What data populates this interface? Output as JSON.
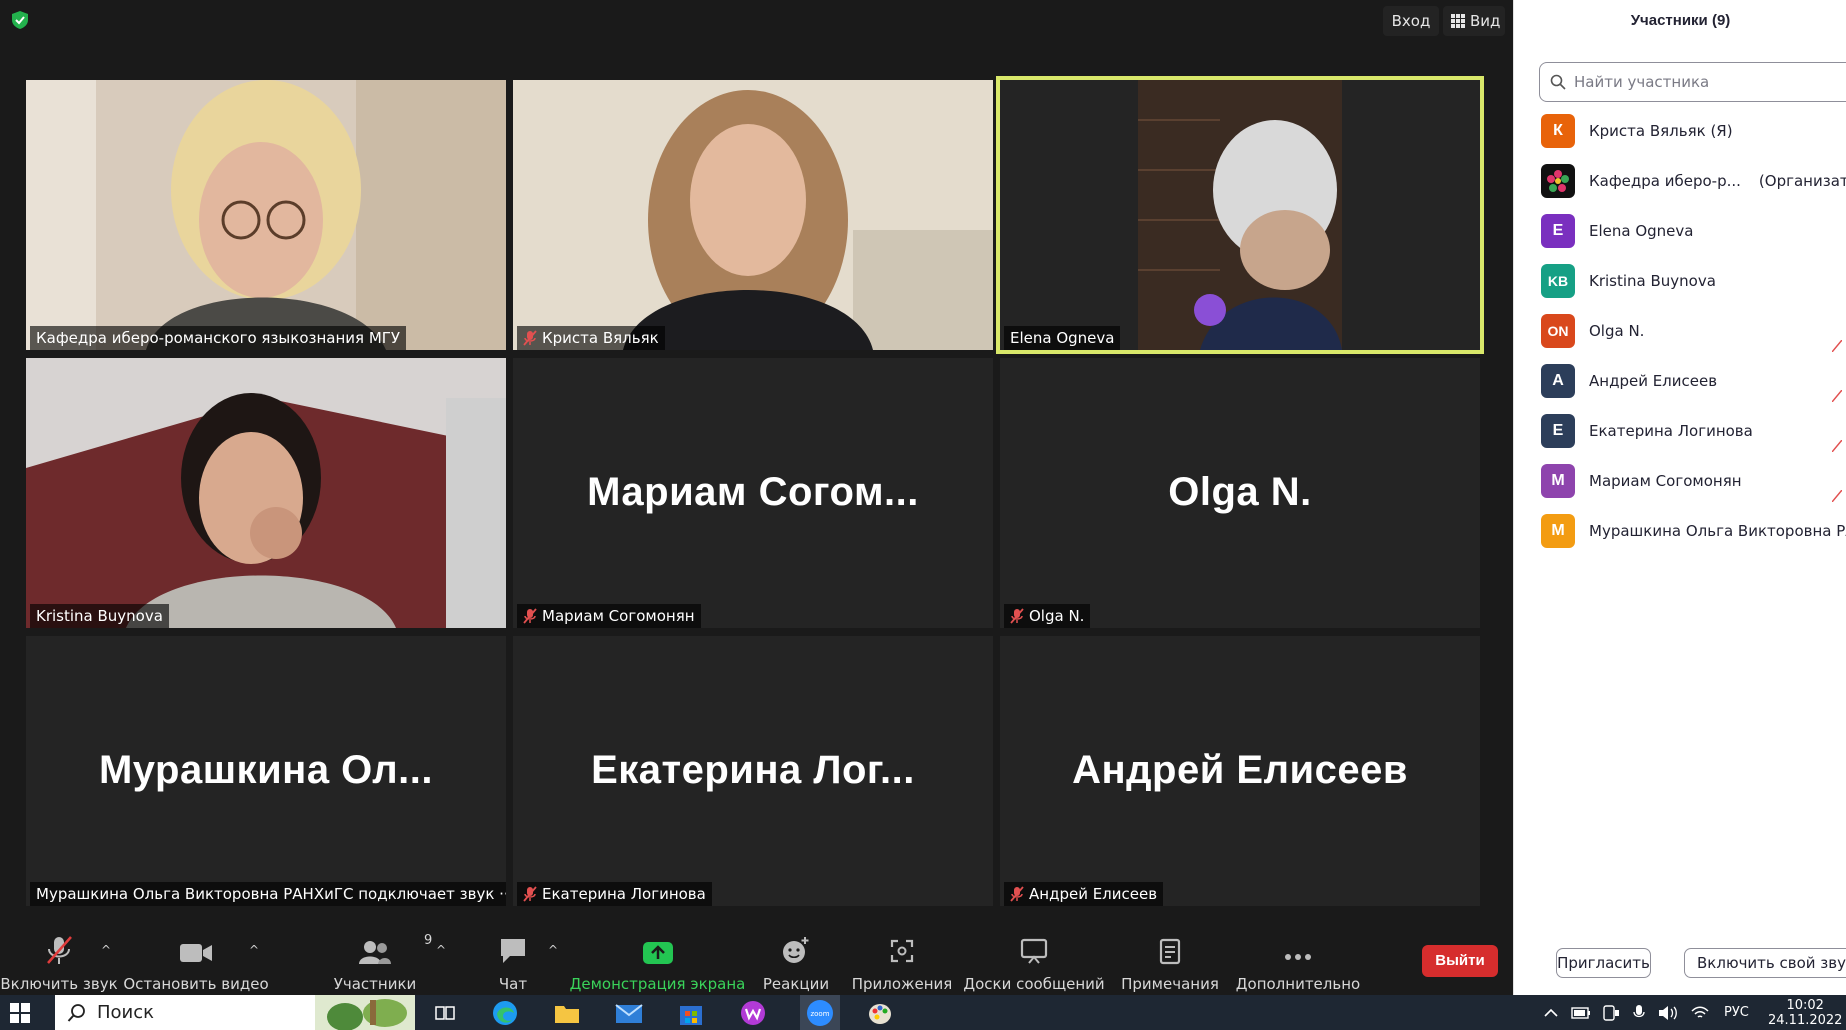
{
  "top_bar": {
    "login_label": "Вход",
    "view_label": "Вид"
  },
  "tiles": [
    {
      "type": "video",
      "tag": "Кафедра иберо-романского языкознания МГУ",
      "muted": false,
      "active": false
    },
    {
      "type": "video",
      "tag": "Криста Вяльяк",
      "muted": true,
      "active": false
    },
    {
      "type": "video",
      "tag": "Elena Ogneva",
      "muted": false,
      "active": true
    },
    {
      "type": "video",
      "tag": "Kristina Buynova",
      "muted": false,
      "active": false
    },
    {
      "type": "name",
      "big": "Мариам  Согом...",
      "tag": "Мариам Согомонян",
      "muted": true
    },
    {
      "type": "name",
      "big": "Olga N.",
      "tag": "Olga N.",
      "muted": true
    },
    {
      "type": "name",
      "big": "Мурашкина  Ол...",
      "tag": "Мурашкина Ольга Викторовна РАНХиГС подключает звук ··",
      "muted": false
    },
    {
      "type": "name",
      "big": "Екатерина  Лог...",
      "tag": "Екатерина Логинова",
      "muted": true
    },
    {
      "type": "name",
      "big": "Андрей Елисеев",
      "tag": "Андрей Елисеев",
      "muted": true
    }
  ],
  "toolbar": {
    "audio": "Включить звук",
    "video": "Остановить видео",
    "participants": "Участники",
    "participants_count": "9",
    "chat": "Чат",
    "share": "Демонстрация экрана",
    "reactions": "Реакции",
    "apps": "Приложения",
    "whiteboards": "Доски сообщений",
    "notes": "Примечания",
    "more": "Дополнительно",
    "leave": "Выйти"
  },
  "panel": {
    "title": "Участники (9)",
    "search_placeholder": "Найти участника",
    "invite": "Пригласить",
    "own_button": "Включить свой звук",
    "participants": [
      {
        "initials": "К",
        "name": "Криста Вяльяк (Я)",
        "role": "",
        "color": "#e8630a"
      },
      {
        "initials": "",
        "name": "Кафедра иберо-р...",
        "role": "(Организатор)",
        "color": "#111111"
      },
      {
        "initials": "E",
        "name": "Elena Ogneva",
        "role": "",
        "color": "#7a2fbf"
      },
      {
        "initials": "KB",
        "name": "Kristina Buynova",
        "role": "",
        "color": "#16a085"
      },
      {
        "initials": "ON",
        "name": "Olga N.",
        "role": "",
        "color": "#d9481c"
      },
      {
        "initials": "А",
        "name": "Андрей Елисеев",
        "role": "",
        "color": "#2c3e5a"
      },
      {
        "initials": "Е",
        "name": "Екатерина Логинова",
        "role": "",
        "color": "#2c3e5a"
      },
      {
        "initials": "М",
        "name": "Мариам Согомонян",
        "role": "",
        "color": "#8e44ad"
      },
      {
        "initials": "М",
        "name": "Мурашкина Ольга Викторовна РАНХиГС",
        "role": "",
        "color": "#f39c12"
      }
    ]
  },
  "taskbar": {
    "search_label": "Поиск",
    "lang": "РУС",
    "time": "10:02",
    "date": "24.11.2022"
  }
}
